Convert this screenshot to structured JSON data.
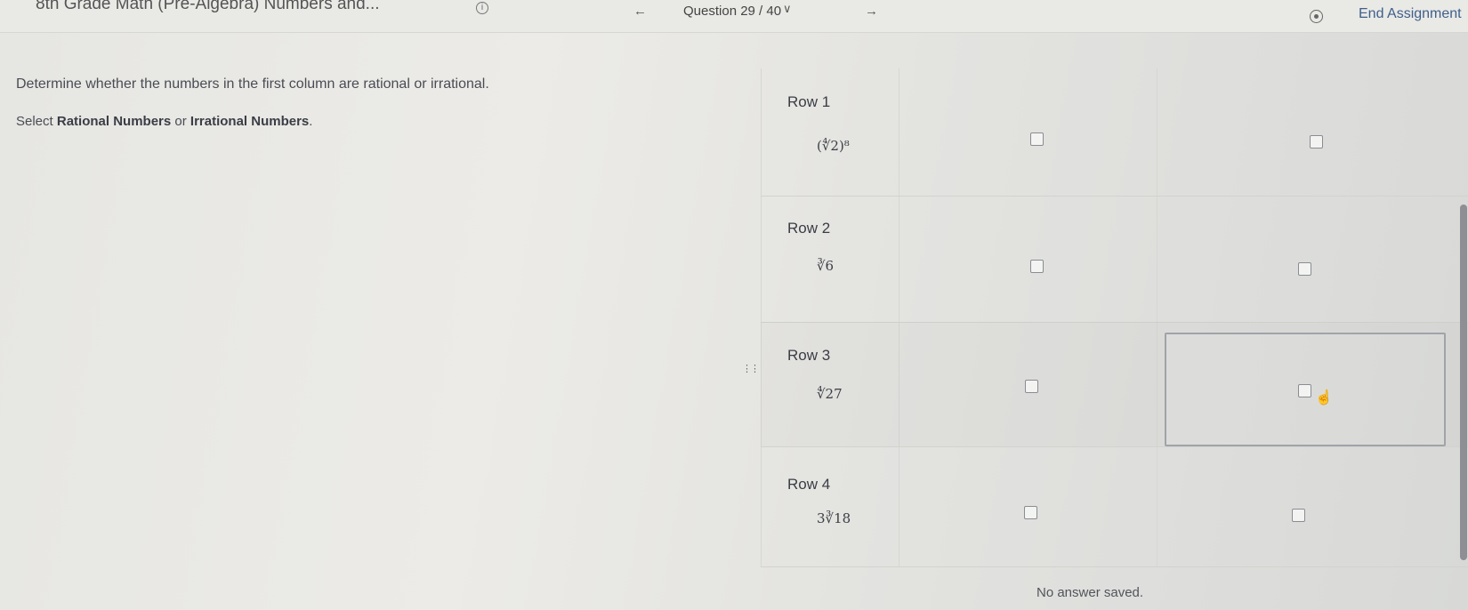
{
  "header": {
    "assignment_title": "8th Grade Math (Pre-Algebra) Numbers and...",
    "question_position": "Question 29 / 40",
    "end_assignment_label": "End Assignment",
    "icons": {
      "info": "info-icon",
      "prev": "arrow-left-icon",
      "next": "arrow-right-icon",
      "settings": "settings-icon",
      "chevron": "chevron-down-icon"
    }
  },
  "prompt": {
    "instructions": "Determine whether the numbers in the first column are rational or irrational.",
    "select_prefix": "Select ",
    "option_a": "Rational Numbers",
    "select_middle": " or ",
    "option_b": "Irrational Numbers",
    "select_suffix": "."
  },
  "rows": [
    {
      "label": "Row 1",
      "expression": "(∜2)⁸",
      "rational_checked": false,
      "irrational_checked": false
    },
    {
      "label": "Row 2",
      "expression": "∛6",
      "rational_checked": false,
      "irrational_checked": false
    },
    {
      "label": "Row 3",
      "expression": "∜27",
      "rational_checked": false,
      "irrational_checked": false
    },
    {
      "label": "Row 4",
      "expression": "3∛18",
      "rational_checked": false,
      "irrational_checked": false
    }
  ],
  "status": {
    "no_answer": "No answer saved."
  }
}
